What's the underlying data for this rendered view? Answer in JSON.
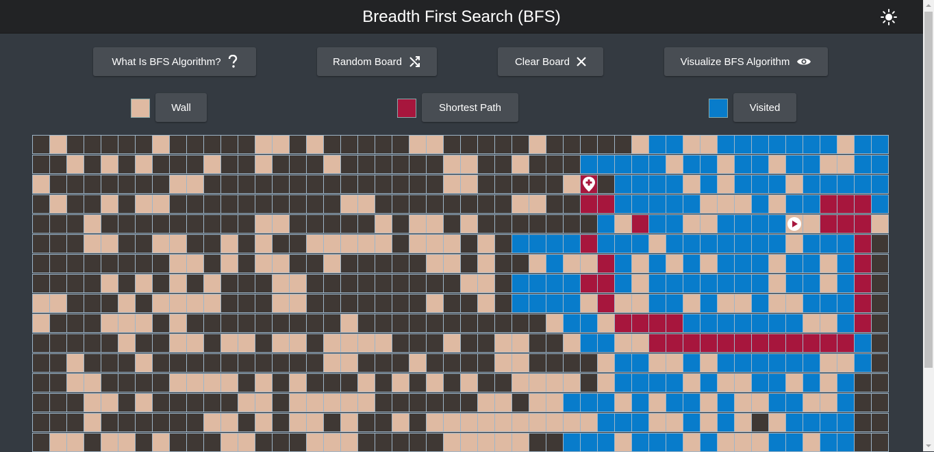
{
  "header": {
    "title": "Breadth First Search (BFS)",
    "theme_icon": "sun-icon"
  },
  "toolbar": {
    "what_is": "What Is BFS Algorithm?",
    "random_board": "Random Board",
    "clear_board": "Clear Board",
    "visualize": "Visualize BFS Algorithm"
  },
  "legend": {
    "wall": "Wall",
    "shortest_path": "Shortest Path",
    "visited": "Visited"
  },
  "colors": {
    "empty": "#3f3834",
    "wall": "#dfbaa2",
    "visited": "#087ccb",
    "path": "#a7163d"
  },
  "grid": {
    "legend": {
      ".": "empty",
      "W": "wall",
      "V": "visited",
      "P": "path"
    },
    "rows": [
      ".W.....W.....WW.W.....WW.....W.....WVVWWVVVVVVVWVVV",
      "..W.W.W...W..W...W......WW..W...VVVVVWVVWVVWVVWWVV",
      "W.......WW..............WW.....WP.VVVVWVWVVVWVVVVV",
      ".W..W.WW..........WW........WW..PPVVVVVWWWVWVVPPPV",
      "...W.........WW.....W.WW.W.......VWPVVWWVVVVWWPPPWP",
      "...WW..WW..W.W..WWWWW.WWW.W.VVVVPVVVWVVVVVVVWVVVP",
      "........WW.W.WW..W.....WW.W..WVWWPVWVWVWVVVWVVWVP",
      "....W.W.W.W...WW.........WW.VVVVPPVWVVVVVVVWVVWVP",
      "WW...W.WWWW...WW.......W..W.VVVVWPWWVVWVWWVWWVVVP",
      "W...WWW.W.........W...........WVVWPPPPVVVVVVVWWVP",
      ".....W..WW.WW.WW.WWWW...W..WW..WVVWWPPPPPPPPPPPPV",
      "..W...W..........WW...W....WW....WVVWWVWVVVVVVWWV",
      "..WW....WWWW.W.W...W.W.W.W..WWWW.WVVVVWVWWVVWVWV",
      "...WW.W.....WW.WWWWW......WW.WWVVVWVWVVWVWWVVWWV",
      "...W......WW.W.WW.W..W.WWWWWWWWWWVVVWWVWVW.WVVVV",
      ".WW.WW.W...WW...WWW.....WWWWW..VVVWVVVWVWWWVVWVV"
    ],
    "start": {
      "row": 4,
      "col": 44
    },
    "target": {
      "row": 2,
      "col": 32
    }
  }
}
